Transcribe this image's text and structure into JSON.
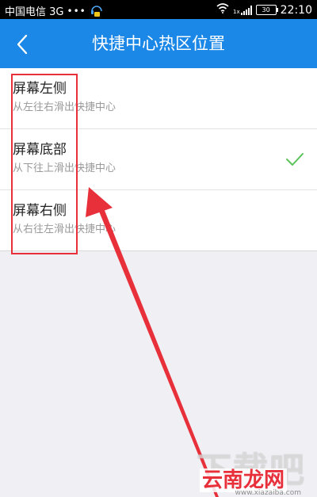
{
  "status_bar": {
    "carrier": "中国电信 3G",
    "dots": "•••",
    "time": "22:10",
    "battery": "30",
    "app_icon": "headset-bag-icon",
    "wifi_icon": "wifi-icon",
    "signal_icon": "signal-icon",
    "signal_prefix": "1x"
  },
  "header": {
    "title": "快捷中心热区位置",
    "back_icon": "chevron-left-icon",
    "background_color": "#1b87e6"
  },
  "list": {
    "items": [
      {
        "title": "屏幕左侧",
        "subtitle": "从左往右滑出快捷中心",
        "selected": false
      },
      {
        "title": "屏幕底部",
        "subtitle": "从下往上滑出快捷中心",
        "selected": true
      },
      {
        "title": "屏幕右侧",
        "subtitle": "从右往左滑出快捷中心",
        "selected": false
      }
    ],
    "check_color": "#5cc35a"
  },
  "annotation": {
    "highlight_color": "#e8303b",
    "arrow_color": "#e8303b"
  },
  "watermark": {
    "big_text": "下载吧",
    "brand": "云南龙网",
    "url": "www.xiazaiba.com"
  }
}
